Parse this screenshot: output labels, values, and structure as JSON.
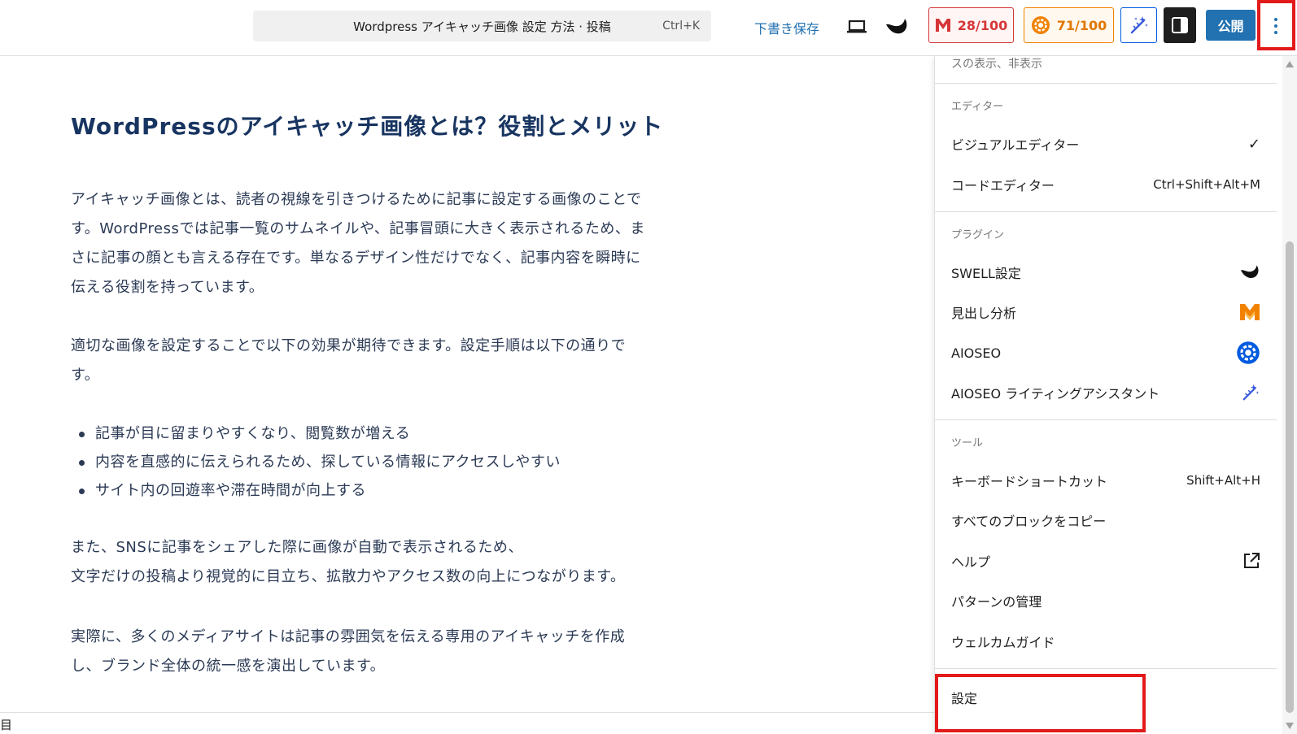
{
  "header": {
    "command_bar": {
      "title": "Wordpress アイキャッチ画像 設定 方法 · 投稿",
      "shortcut": "Ctrl+K"
    },
    "save_draft": "下書き保存",
    "headline_score": "28/100",
    "aioseo_score": "71/100",
    "publish": "公開"
  },
  "post": {
    "heading": "WordPressのアイキャッチ画像とは？役割とメリット",
    "paragraph1": [
      "アイキャッチ画像とは、読者の視線を引きつけるために記事に設定する画像のことで",
      "す。WordPressでは記事一覧のサムネイルや、記事冒頭に大きく表示されるため、ま",
      "さに記事の顔とも言える存在です。単なるデザイン性だけでなく、記事内容を瞬時に",
      "伝える役割を持っています。"
    ],
    "paragraph2": [
      "適切な画像を設定することで以下の効果が期待できます。設定手順は以下の通りで",
      "す。"
    ],
    "bullets": [
      "記事が目に留まりやすくなり、閲覧数が増える",
      "内容を直感的に伝えられるため、探している情報にアクセスしやすい",
      "サイト内の回遊率や滞在時間が向上する"
    ],
    "paragraph3": [
      "また、SNSに記事をシェアした際に画像が自動で表示されるため、",
      "文字だけの投稿より視覚的に目立ち、拡散力やアクセス数の向上につながります。"
    ],
    "paragraph4": [
      "実際に、多くのメディアサイトは記事の雰囲気を伝える専用のアイキャッチを作成",
      "し、ブランド全体の統一感を演出しています。"
    ]
  },
  "footer": {
    "breadcrumb": "目"
  },
  "menu": {
    "truncated_item": "スの表示、非表示",
    "editor_group": {
      "label": "エディター",
      "items": [
        {
          "label": "ビジュアルエディター",
          "right": "✓"
        },
        {
          "label": "コードエディター",
          "right": "Ctrl+Shift+Alt+M"
        }
      ]
    },
    "plugins_group": {
      "label": "プラグイン",
      "items": [
        {
          "label": "SWELL設定",
          "icon": "swell-icon"
        },
        {
          "label": "見出し分析",
          "icon": "headline-analyzer-icon"
        },
        {
          "label": "AIOSEO",
          "icon": "aioseo-icon"
        },
        {
          "label": "AIOSEO ライティングアシスタント",
          "icon": "ai-wand-icon"
        }
      ]
    },
    "tools_group": {
      "label": "ツール",
      "items": [
        {
          "label": "キーボードショートカット",
          "right": "Shift+Alt+H"
        },
        {
          "label": "すべてのブロックをコピー"
        },
        {
          "label": "ヘルプ",
          "icon": "external-link-icon"
        },
        {
          "label": "パターンの管理"
        },
        {
          "label": "ウェルカムガイド"
        }
      ]
    },
    "settings": "設定"
  },
  "colors": {
    "accent": "#2271b1",
    "highlight": "#e31a1a",
    "heading": "#183561",
    "score_red": "#d63638",
    "score_orange": "#f18200"
  }
}
